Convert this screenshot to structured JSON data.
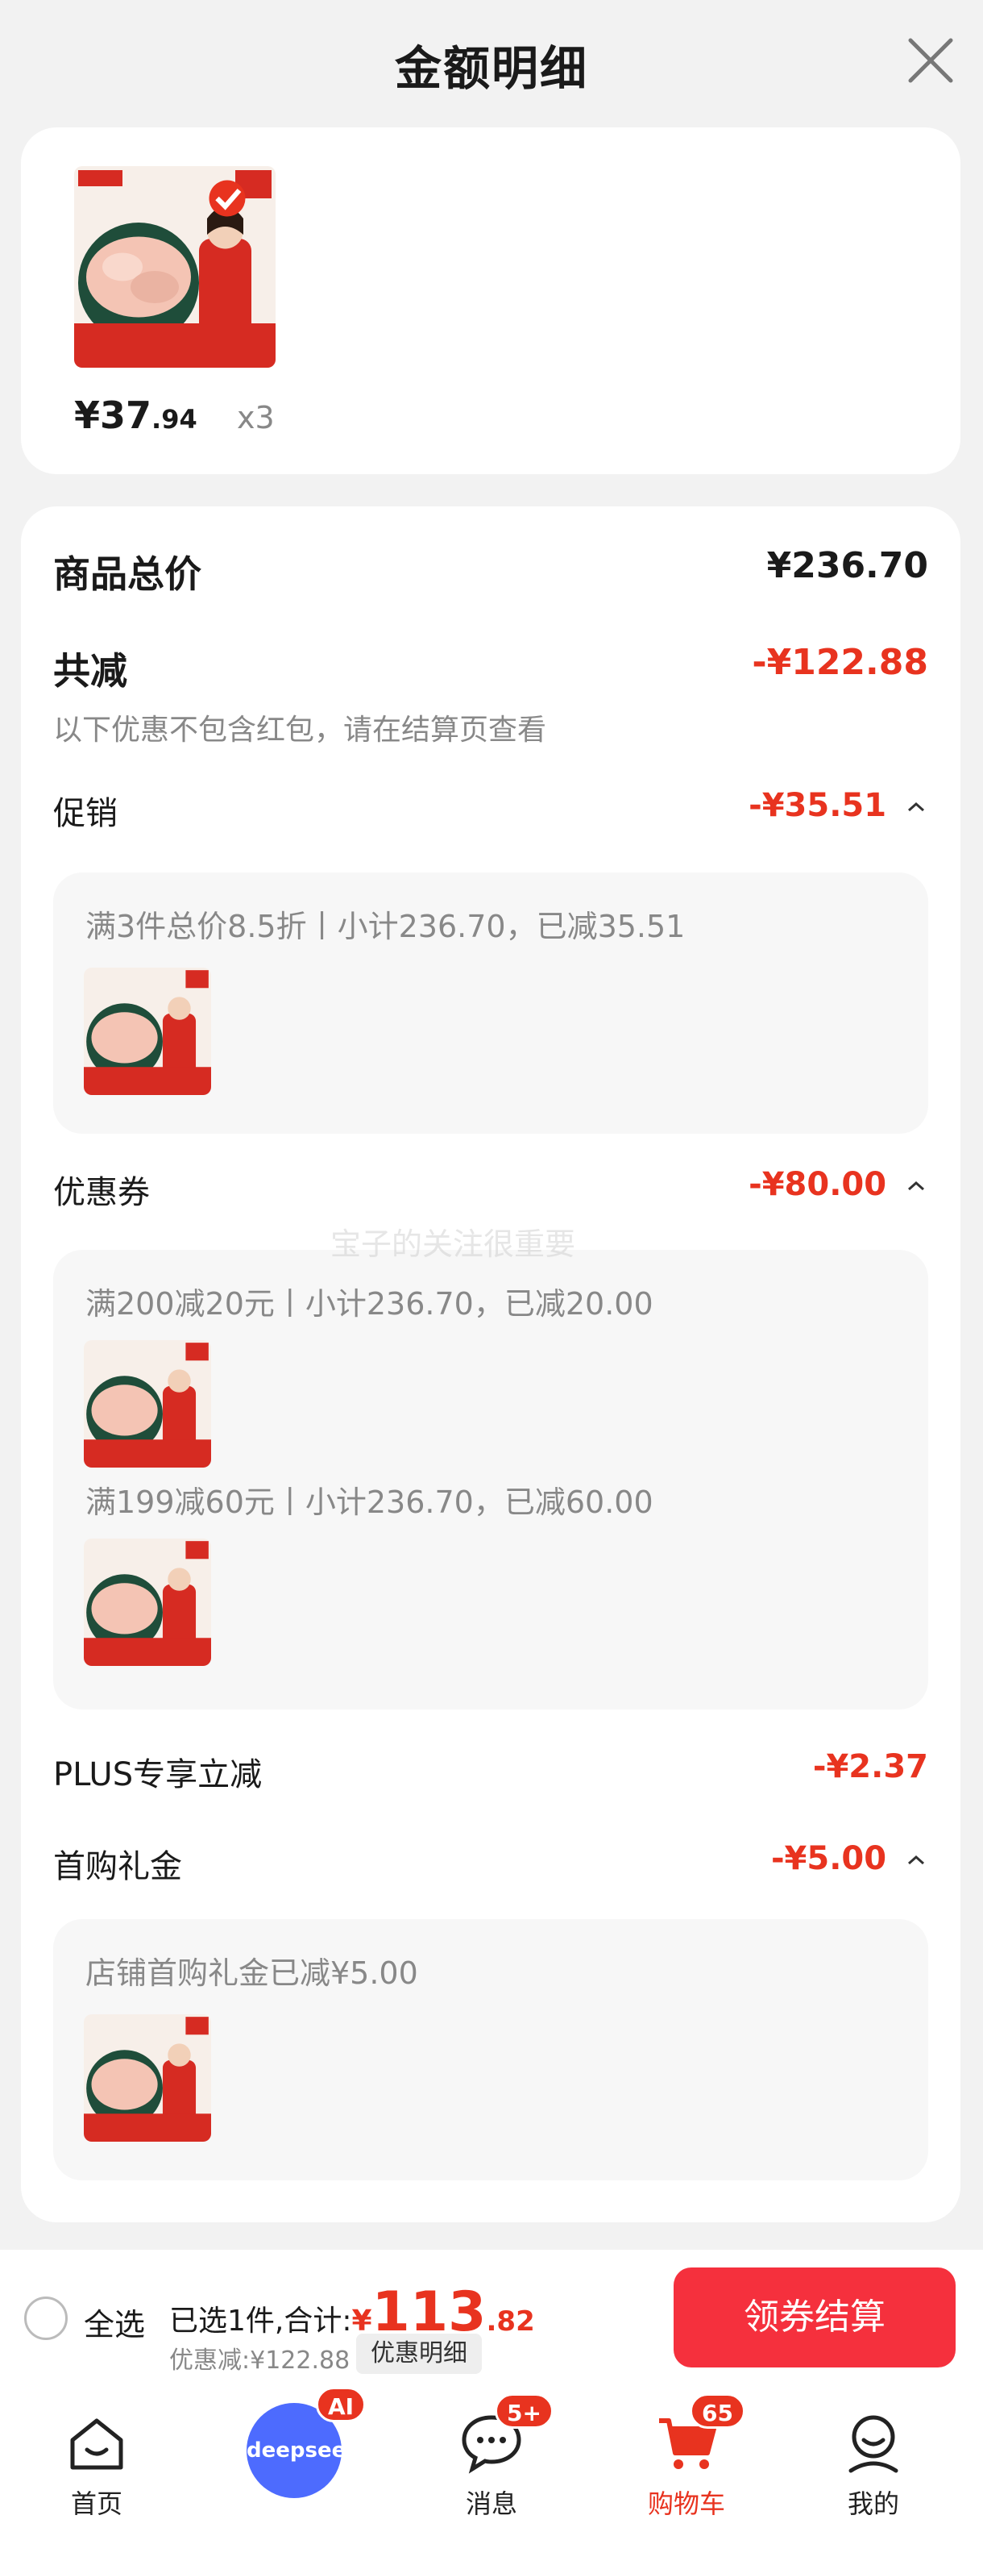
{
  "header": {
    "title": "金额明细"
  },
  "product": {
    "price_main": "¥37",
    "price_decimal": ".94",
    "quantity": "x3"
  },
  "summary": {
    "total_label": "商品总价",
    "total_value": "¥236.70",
    "reduce_label": "共减",
    "reduce_value": "-¥122.88",
    "note": "以下优惠不包含红包，请在结算页查看"
  },
  "promo": {
    "label": "促销",
    "value": "-¥35.51",
    "line": "满3件总价8.5折丨小计236.70，已减35.51"
  },
  "coupon": {
    "label": "优惠券",
    "value": "-¥80.00",
    "line1": "满200减20元丨小计236.70，已减20.00",
    "line2": "满199减60元丨小计236.70，已减60.00"
  },
  "plus": {
    "label": "PLUS专享立减",
    "value": "-¥2.37"
  },
  "gift": {
    "label": "首购礼金",
    "value": "-¥5.00",
    "line": "店铺首购礼金已减¥5.00"
  },
  "watermark": "宝子的关注很重要",
  "checkout": {
    "select_all": "全选",
    "selected_text": "已选1件,合计:",
    "currency": "¥",
    "total_int": "113",
    "total_dec": ".82",
    "discount_text": "优惠减:¥122.88",
    "discount_button": "优惠明细",
    "pay_button": "领券结算"
  },
  "tabbar": {
    "home": "首页",
    "deepseek": "deepseek",
    "ai_badge": "AI",
    "messages": "消息",
    "messages_badge": "5+",
    "cart": "购物车",
    "cart_badge": "65",
    "mine": "我的"
  },
  "colors": {
    "accent": "#e8331f",
    "pay_button": "#f5303d",
    "deepseek_blue": "#4d6bfe"
  }
}
